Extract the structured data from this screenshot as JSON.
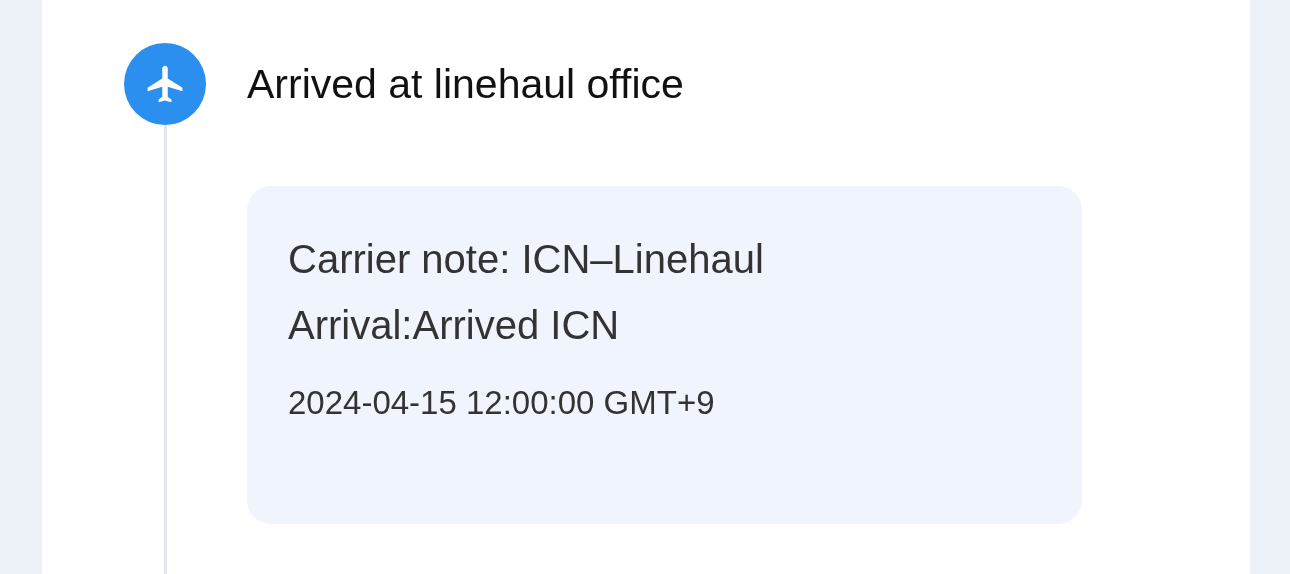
{
  "event": {
    "title": "Arrived at linehaul office",
    "note": "Carrier note: ICN–Linehaul Arrival:Arrived ICN",
    "time": "2024-04-15 12:00:00 GMT+9"
  }
}
